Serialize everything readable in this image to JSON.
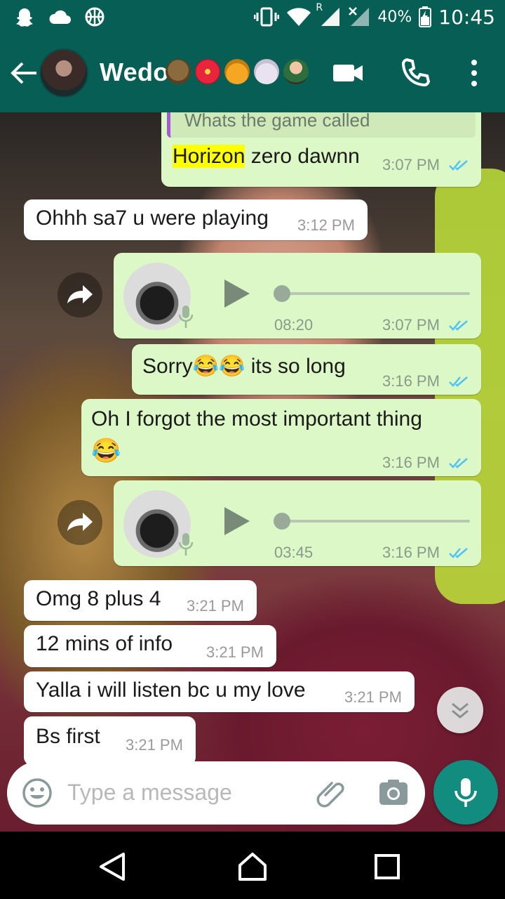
{
  "status_bar": {
    "battery_percent": "40%",
    "time": "10:45",
    "network_label": "R"
  },
  "header": {
    "contact_name": "Wedo",
    "name_emojis": [
      "owl-emoji",
      "hibiscus-emoji",
      "honey-pot-emoji",
      "rabbit-emoji",
      "woman-emoji"
    ]
  },
  "messages": [
    {
      "type": "text",
      "direction": "outgoing",
      "quoted": "Whats the game called",
      "highlight": "Horizon",
      "text": " zero dawnn",
      "time": "3:07 PM",
      "status": "read"
    },
    {
      "type": "text",
      "direction": "incoming",
      "text": "Ohhh sa7 u were playing",
      "time": "3:12 PM"
    },
    {
      "type": "voice",
      "direction": "outgoing",
      "duration": "08:20",
      "time": "3:07 PM",
      "status": "read"
    },
    {
      "type": "text",
      "direction": "outgoing",
      "text": "Sorry😂😂 its so long",
      "time": "3:16 PM",
      "status": "read"
    },
    {
      "type": "text",
      "direction": "outgoing",
      "text": "Oh I forgot the most important thing",
      "text2": "😂",
      "time": "3:16 PM",
      "status": "read"
    },
    {
      "type": "voice",
      "direction": "outgoing",
      "duration": "03:45",
      "time": "3:16 PM",
      "status": "read"
    },
    {
      "type": "text",
      "direction": "incoming",
      "text": "Omg 8 plus 4",
      "time": "3:21 PM"
    },
    {
      "type": "text",
      "direction": "incoming",
      "text": "12 mins of info",
      "time": "3:21 PM"
    },
    {
      "type": "text",
      "direction": "incoming",
      "text": "Yalla i will listen bc u my love",
      "time": "3:21 PM"
    },
    {
      "type": "text",
      "direction": "incoming",
      "text": "Bs first",
      "time": "3:21 PM"
    }
  ],
  "input": {
    "placeholder": "Type a message"
  },
  "colors": {
    "header": "#075e54",
    "outgoing_bubble": "#dcf8c6",
    "incoming_bubble": "#ffffff",
    "mic_button": "#128c7e",
    "read_ticks": "#4fc3f7"
  }
}
